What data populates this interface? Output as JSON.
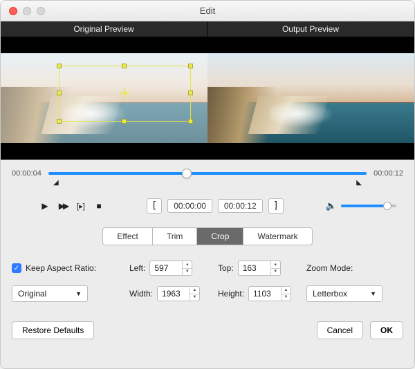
{
  "window": {
    "title": "Edit"
  },
  "preview": {
    "original_label": "Original Preview",
    "output_label": "Output Preview"
  },
  "timeline": {
    "start_time": "00:00:04",
    "end_time": "00:00:12",
    "playhead_pct": 42
  },
  "bracket": {
    "in_time": "00:00:00",
    "out_time": "00:00:12"
  },
  "volume": {
    "level_pct": 80
  },
  "tabs": {
    "effect": "Effect",
    "trim": "Trim",
    "crop": "Crop",
    "watermark": "Watermark",
    "active": "crop"
  },
  "crop": {
    "keep_ratio_label": "Keep Aspect Ratio:",
    "keep_ratio_checked": true,
    "left_label": "Left:",
    "left_value": "597",
    "top_label": "Top:",
    "top_value": "163",
    "width_label": "Width:",
    "width_value": "1963",
    "height_label": "Height:",
    "height_value": "1103",
    "aspect_options": [
      "Original"
    ],
    "aspect_selected": "Original",
    "zoom_label": "Zoom Mode:",
    "zoom_options": [
      "Letterbox"
    ],
    "zoom_selected": "Letterbox"
  },
  "footer": {
    "restore": "Restore Defaults",
    "cancel": "Cancel",
    "ok": "OK"
  }
}
